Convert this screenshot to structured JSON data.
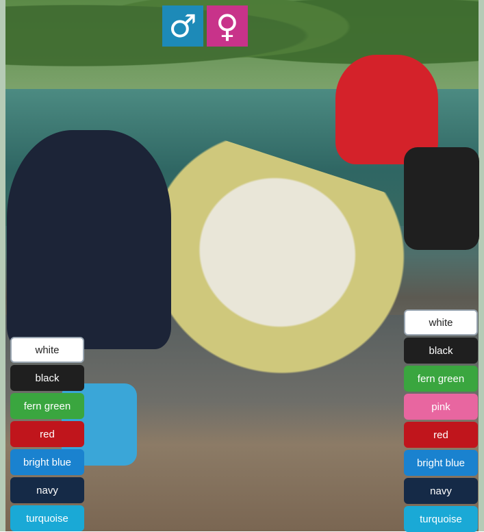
{
  "gender_icons": [
    {
      "symbol": "♂",
      "color": "#1d8ab8",
      "icon": "male-icon"
    },
    {
      "symbol": "♀",
      "color": "#c8338a",
      "icon": "female-icon"
    }
  ],
  "men_colors": [
    {
      "label": "white",
      "bg": "#ffffff",
      "text": "#222222"
    },
    {
      "label": "black",
      "bg": "#1f1f1f",
      "text": "#ffffff"
    },
    {
      "label": "fern green",
      "bg": "#3aa63f",
      "text": "#ffffff"
    },
    {
      "label": "red",
      "bg": "#c0151c",
      "text": "#ffffff"
    },
    {
      "label": "bright blue",
      "bg": "#1a82cf",
      "text": "#ffffff"
    },
    {
      "label": "navy",
      "bg": "#152a47",
      "text": "#ffffff"
    },
    {
      "label": "turquoise",
      "bg": "#1aa9d6",
      "text": "#ffffff"
    }
  ],
  "women_colors": [
    {
      "label": "white",
      "bg": "#ffffff",
      "text": "#222222"
    },
    {
      "label": "black",
      "bg": "#1f1f1f",
      "text": "#ffffff"
    },
    {
      "label": "fern green",
      "bg": "#3aa63f",
      "text": "#ffffff"
    },
    {
      "label": "pink",
      "bg": "#e866a0",
      "text": "#ffffff"
    },
    {
      "label": "red",
      "bg": "#c0151c",
      "text": "#ffffff"
    },
    {
      "label": "bright blue",
      "bg": "#1a82cf",
      "text": "#ffffff"
    },
    {
      "label": "navy",
      "bg": "#152a47",
      "text": "#ffffff"
    },
    {
      "label": "turquoise",
      "bg": "#1aa9d6",
      "text": "#ffffff"
    }
  ]
}
